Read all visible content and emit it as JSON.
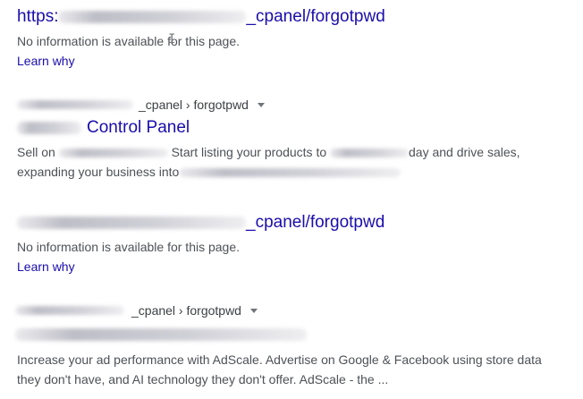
{
  "results": [
    {
      "title_prefix": "https:",
      "title_suffix": "_cpanel/forgotpwd",
      "snippet": "No information is available for this page.",
      "learn_why": "Learn why"
    },
    {
      "cite_path": "_cpanel › forgotpwd",
      "title_suffix": "Control Panel",
      "snippet_a": "Sell on",
      "snippet_b": "Start listing your products to",
      "snippet_c": "day and drive sales,",
      "snippet_d": "expanding your business into"
    },
    {
      "title_suffix": "_cpanel/forgotpwd",
      "snippet": "No information is available for this page.",
      "learn_why": "Learn why"
    },
    {
      "cite_path": "_cpanel › forgotpwd",
      "snippet_line1": "Increase your ad performance with AdScale. Advertise on Google & Facebook using store data",
      "snippet_line2": "they don't have, and AI technology they don't offer. AdScale - the ..."
    }
  ],
  "colors": {
    "link": "#1a0dab",
    "text": "#4d5156",
    "cite": "#3c4043"
  },
  "icons": {
    "cite_menu": "caret-down-icon",
    "cursor": "text-cursor-icon"
  }
}
